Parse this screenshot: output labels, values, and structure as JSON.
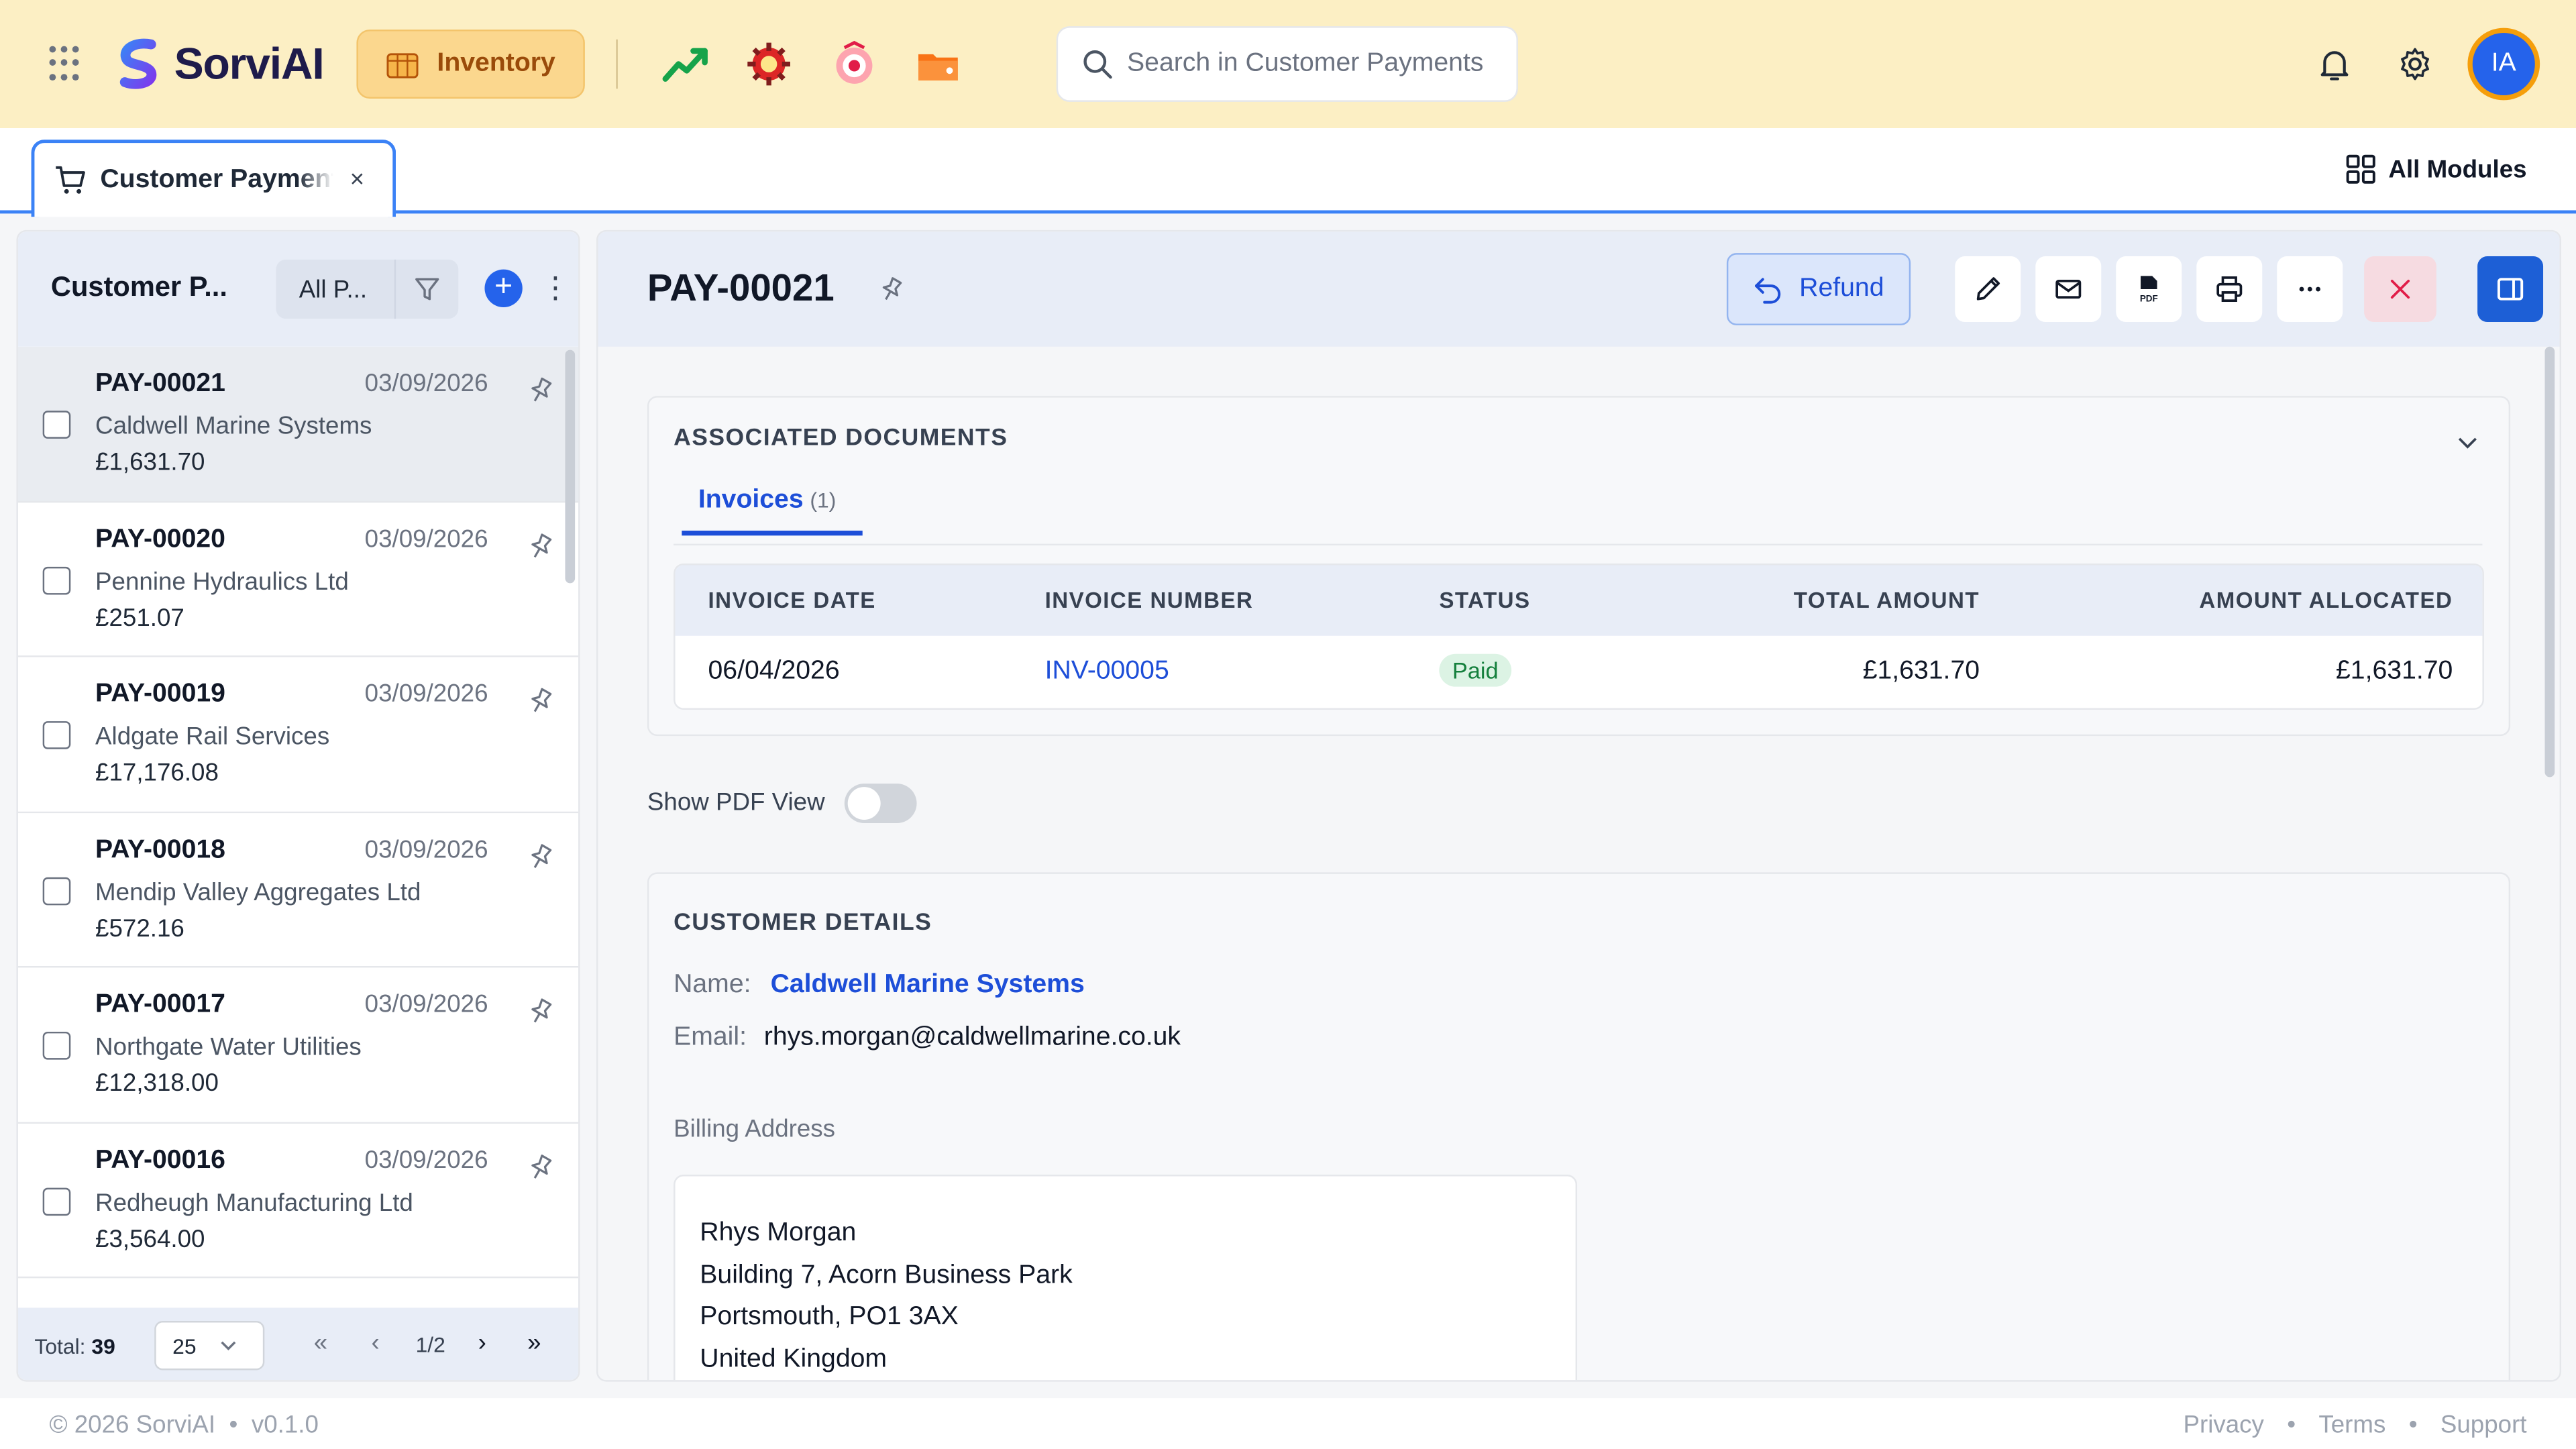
{
  "app": {
    "brand": "SorviAI",
    "module": "Inventory"
  },
  "search": {
    "placeholder": "Search in Customer Payments"
  },
  "user": {
    "initials": "IA"
  },
  "tab": {
    "label": "Customer Payments",
    "close": "×"
  },
  "all_modules": "All Modules",
  "list": {
    "title": "Customer P...",
    "filter_label": "All P...",
    "items": [
      {
        "id": "PAY-00021",
        "date": "03/09/2026",
        "customer": "Caldwell Marine Systems",
        "amount": "£1,631.70",
        "selected": true
      },
      {
        "id": "PAY-00020",
        "date": "03/09/2026",
        "customer": "Pennine Hydraulics Ltd",
        "amount": "£251.07"
      },
      {
        "id": "PAY-00019",
        "date": "03/09/2026",
        "customer": "Aldgate Rail Services",
        "amount": "£17,176.08"
      },
      {
        "id": "PAY-00018",
        "date": "03/09/2026",
        "customer": "Mendip Valley Aggregates Ltd",
        "amount": "£572.16"
      },
      {
        "id": "PAY-00017",
        "date": "03/09/2026",
        "customer": "Northgate Water Utilities",
        "amount": "£12,318.00"
      },
      {
        "id": "PAY-00016",
        "date": "03/09/2026",
        "customer": "Redheugh Manufacturing Ltd",
        "amount": "£3,564.00"
      }
    ],
    "total_label": "Total:",
    "total": "39",
    "page_size": "25",
    "page": "1/2"
  },
  "detail": {
    "title": "PAY-00021",
    "refund_label": "Refund",
    "associated": {
      "title": "ASSOCIATED DOCUMENTS",
      "tab_label": "Invoices",
      "tab_count": "(1)",
      "columns": [
        "INVOICE DATE",
        "INVOICE NUMBER",
        "STATUS",
        "TOTAL AMOUNT",
        "AMOUNT ALLOCATED"
      ],
      "rows": [
        {
          "date": "06/04/2026",
          "number": "INV-00005",
          "status": "Paid",
          "total": "£1,631.70",
          "allocated": "£1,631.70"
        }
      ]
    },
    "pdf_view_label": "Show PDF View",
    "pdf_view_on": false,
    "customer": {
      "title": "CUSTOMER DETAILS",
      "name_label": "Name:",
      "name": "Caldwell Marine Systems",
      "email_label": "Email:",
      "email": "rhys.morgan@caldwellmarine.co.uk",
      "billing_label": "Billing Address",
      "address": [
        "Rhys Morgan",
        "Building 7, Acorn Business Park",
        "Portsmouth, PO1 3AX",
        "United Kingdom"
      ]
    }
  },
  "footer": {
    "copyright": "© 2026 SorviAI",
    "dot": "•",
    "version": "v0.1.0",
    "links": [
      "Privacy",
      "Terms",
      "Support"
    ]
  },
  "colors": {
    "accent": "#2563eb",
    "topbar": "#fcefc4",
    "module_pill": "#fbd78e",
    "paid_badge": "#dcf3e4"
  }
}
